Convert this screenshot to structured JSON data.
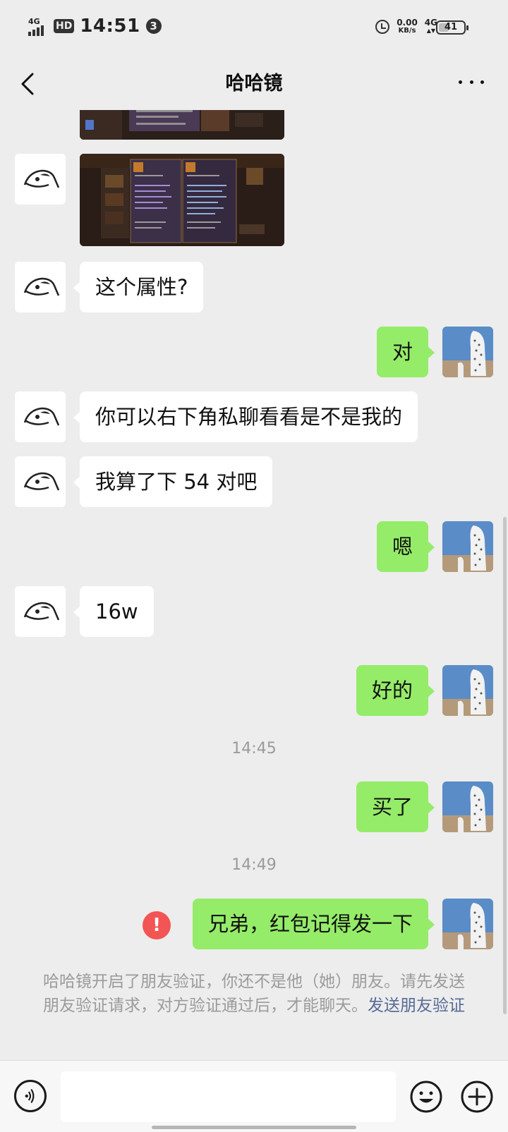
{
  "status_bar": {
    "network": "4G",
    "hd": "HD",
    "time": "14:51",
    "notification_count": "3",
    "speed_value": "0.00",
    "speed_unit": "KB/s",
    "network_right": "4G",
    "battery": "41",
    "battery_level": 0.41
  },
  "header": {
    "title": "哈哈镜"
  },
  "messages": [
    {
      "side": "left",
      "type": "image"
    },
    {
      "side": "left",
      "type": "image"
    },
    {
      "side": "left",
      "text": "这个属性?"
    },
    {
      "side": "right",
      "text": "对"
    },
    {
      "side": "left",
      "text": "你可以右下角私聊看看是不是我的"
    },
    {
      "side": "left",
      "text": "我算了下 54 对吧"
    },
    {
      "side": "right",
      "text": "嗯"
    },
    {
      "side": "left",
      "text": "16w"
    },
    {
      "side": "right",
      "text": "好的"
    },
    {
      "side": "right",
      "text": "买了"
    },
    {
      "side": "right",
      "text": "兄弟，红包记得发一下",
      "failed": true
    }
  ],
  "timestamps": [
    "14:45",
    "14:49"
  ],
  "notice": {
    "text": "哈哈镜开启了朋友验证，你还不是他（她）朋友。请先发送朋友验证请求，对方验证通过后，才能聊天。",
    "link": "发送朋友验证"
  },
  "colors": {
    "background": "#ededed",
    "bubble_self": "#95ec69",
    "bubble_other": "#ffffff",
    "link": "#576b95",
    "error": "#f25553"
  },
  "icons": {
    "back": "back-arrow-icon",
    "more": "more-dots-icon",
    "voice": "voice-icon",
    "emoji": "emoji-icon",
    "plus": "plus-icon",
    "error": "error-icon"
  }
}
